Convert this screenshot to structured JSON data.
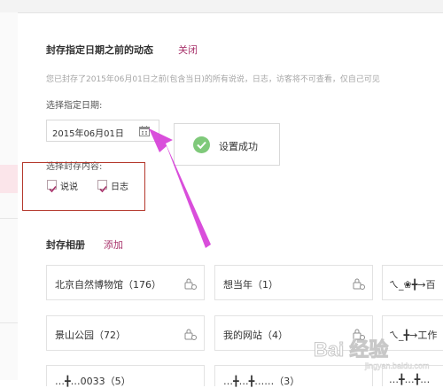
{
  "archive": {
    "title": "封存指定日期之前的动态",
    "close_label": "关闭",
    "description": "您已封存了2015年06月01日之前(包含当日)的所有说说，日志，访客将不可查看，仅自己可见",
    "date_label": "选择指定日期:",
    "date_value": "2015年06月01日",
    "content_label": "选择封存内容:",
    "options": [
      {
        "label": "说说",
        "checked": true
      },
      {
        "label": "日志",
        "checked": true
      }
    ]
  },
  "toast": {
    "message": "设置成功"
  },
  "albums": {
    "title": "封存相册",
    "add_label": "添加",
    "rows": [
      [
        "北京自然博物馆（176）",
        "想当年（1）",
        "ㄟ_❀╋→百"
      ],
      [
        "景山公园（72）",
        "我的网站（4）",
        "ㄟ_╋→工作"
      ],
      [
        "…╋…0033（5）",
        "…╋…╋……（3）",
        "…╋…╋…"
      ]
    ]
  },
  "watermark": {
    "text": "Bai 经验",
    "sub": "jingyan.baidu.com"
  },
  "colors": {
    "accent": "#a8336b",
    "success": "#7fc97a",
    "highlight_box": "#b4382c",
    "arrow": "#d63fd8"
  }
}
